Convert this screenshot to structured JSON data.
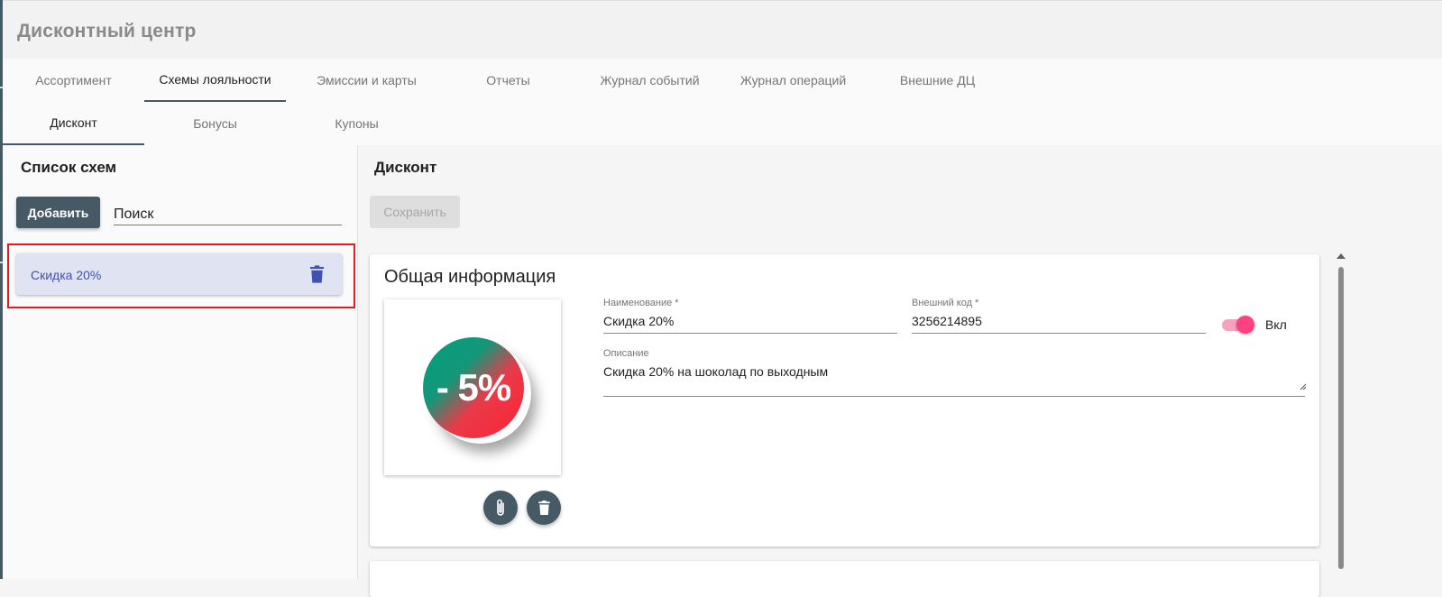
{
  "app": {
    "title": "Дисконтный центр"
  },
  "tabs": [
    {
      "label": "Ассортимент",
      "active": false
    },
    {
      "label": "Схемы лояльности",
      "active": true
    },
    {
      "label": "Эмиссии и карты",
      "active": false
    },
    {
      "label": "Отчеты",
      "active": false
    },
    {
      "label": "Журнал событий",
      "active": false
    },
    {
      "label": "Журнал операций",
      "active": false
    },
    {
      "label": "Внешние ДЦ",
      "active": false
    }
  ],
  "subtabs": [
    {
      "label": "Дисконт",
      "active": true
    },
    {
      "label": "Бонусы",
      "active": false
    },
    {
      "label": "Купоны",
      "active": false
    }
  ],
  "left": {
    "title": "Список схем",
    "add_label": "Добавить",
    "search_placeholder": "Поиск",
    "items": [
      {
        "label": "Скидка 20%",
        "selected": true
      }
    ]
  },
  "right": {
    "title": "Дисконт",
    "save_label": "Сохранить",
    "card": {
      "title": "Общая информация",
      "image_text": "- 5%",
      "name": {
        "label": "Наименование *",
        "value": "Скидка 20%"
      },
      "code": {
        "label": "Внешний код *",
        "value": "3256214895"
      },
      "toggle": {
        "label": "Вкл",
        "on": true
      },
      "description": {
        "label": "Описание",
        "value": "Скидка 20% на шоколад по выходным"
      }
    }
  },
  "colors": {
    "primary": "#455a64",
    "accent": "#ff4081",
    "selected_item_bg": "#e0e3f1",
    "selected_item_text": "#3f51b5",
    "highlight_border": "#e11b22"
  },
  "icons": {
    "item_delete": "trash-icon",
    "attach": "paperclip-icon",
    "image_delete": "trash-icon"
  }
}
